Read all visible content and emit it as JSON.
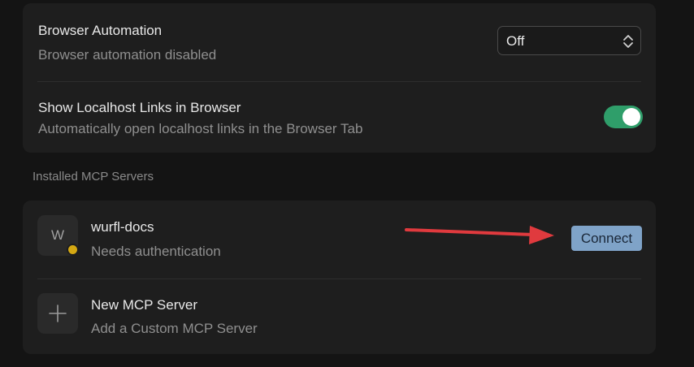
{
  "settings": {
    "browser_automation": {
      "title": "Browser Automation",
      "subtitle": "Browser automation disabled",
      "selected": "Off"
    },
    "localhost_links": {
      "title": "Show Localhost Links in Browser",
      "subtitle": "Automatically open localhost links in the Browser Tab",
      "enabled": true
    }
  },
  "mcp": {
    "section_label": "Installed MCP Servers",
    "servers": [
      {
        "avatar_letter": "W",
        "name": "wurfl-docs",
        "status": "Needs authentication",
        "status_color": "#d4a813",
        "action_label": "Connect"
      }
    ],
    "new_server": {
      "title": "New MCP Server",
      "subtitle": "Add a Custom MCP Server",
      "icon": "plus-icon"
    }
  },
  "colors": {
    "toggle_on": "#2f9e6a",
    "connect_button": "#7fa3c8",
    "annotation_arrow": "#e03a3e"
  },
  "icons": {
    "select": "chevron-up-down-icon",
    "annotation": "red-arrow-icon"
  }
}
